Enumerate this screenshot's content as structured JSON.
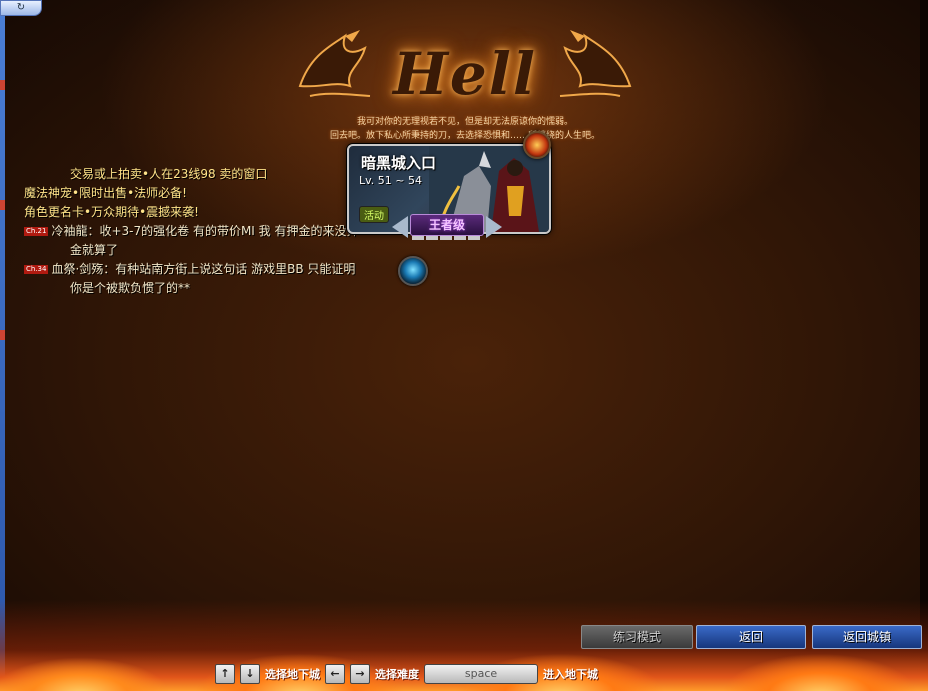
{
  "window": {
    "corner_label": "↻"
  },
  "header": {
    "title": "Hell",
    "quote_line1": "我可对你的无理视若不见，但是却无法原谅你的懦弱。",
    "quote_line2": "回去吧。放下私心所秉持的刀，去选择恐惧和……所缠绕的人生吧。"
  },
  "chat": {
    "lines": [
      {
        "text": "交易或上拍卖•人在23线98 卖的窗口"
      },
      {
        "text": "魔法神宠•限时出售•法师必备!"
      },
      {
        "text": "角色更名卡•万众期待•震撼来袭!"
      },
      {
        "badge": "Ch.21",
        "text": "冷袖龍：收+3-7的强化卷 有的带价MI 我 有押金的来没押"
      },
      {
        "text": "金就算了"
      },
      {
        "badge": "Ch.34",
        "text": "血祭·剑殇：有种站南方街上说这句话 游戏里BB 只能证明"
      },
      {
        "text": "你是个被欺负惯了的**"
      }
    ]
  },
  "dungeon": {
    "name": "暗黑城入口",
    "level_range": "Lv. 51 ~ 54",
    "event_tag": "活动",
    "difficulty": "王者级",
    "difficulty_level": 5,
    "difficulty_max": 5
  },
  "buttons": {
    "practice": "练习模式",
    "back": "返回",
    "back_to_town": "返回城镇"
  },
  "hint": {
    "up_key": "↑",
    "down_key": "↓",
    "select_dungeon": "选择地下城",
    "left_key": "←",
    "right_key": "→",
    "select_difficulty": "选择难度",
    "space_key": "space",
    "enter_dungeon": "进入地下城"
  },
  "colors": {
    "accent_blue": "#16367c",
    "chat_text": "#f1e6c8",
    "channel_badge": "#b01a10",
    "difficulty_purple": "#5a2a7a"
  }
}
